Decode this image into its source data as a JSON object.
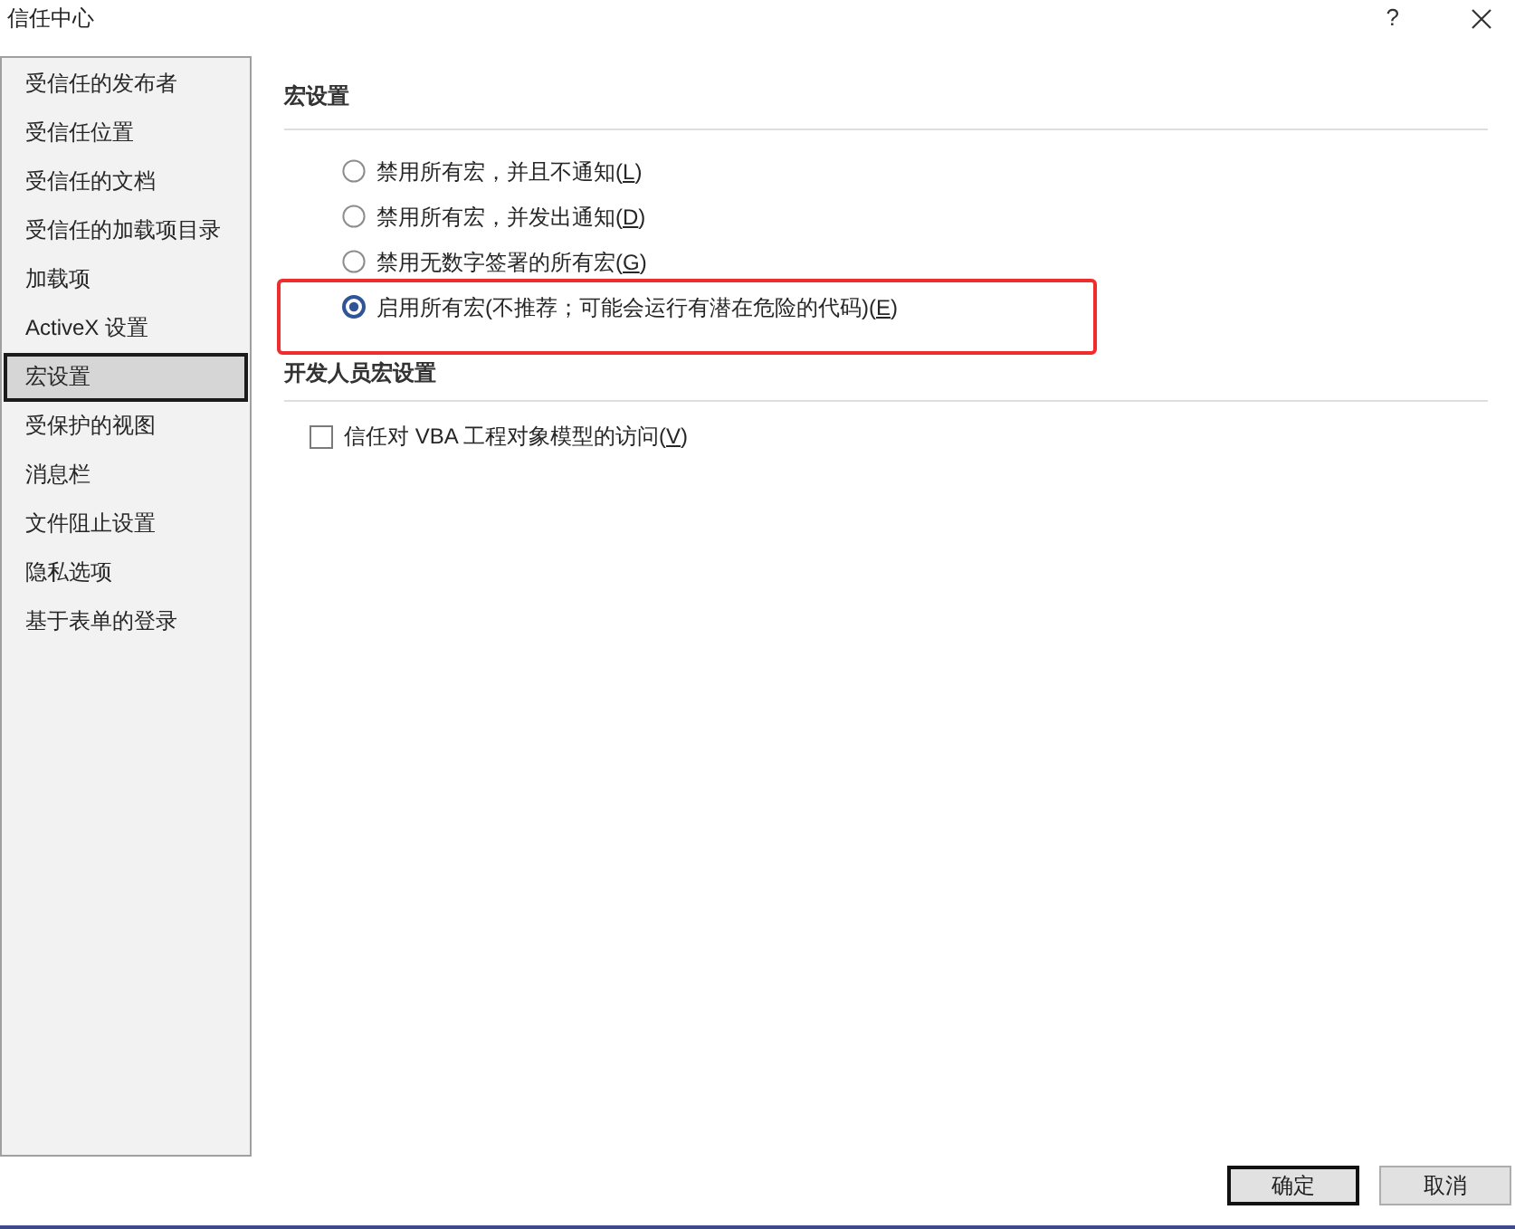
{
  "window": {
    "title": "信任中心",
    "help": "?"
  },
  "sidebar": {
    "items": [
      {
        "label": "受信任的发布者",
        "selected": false
      },
      {
        "label": "受信任位置",
        "selected": false
      },
      {
        "label": "受信任的文档",
        "selected": false
      },
      {
        "label": "受信任的加载项目录",
        "selected": false
      },
      {
        "label": "加载项",
        "selected": false
      },
      {
        "label": "ActiveX 设置",
        "selected": false
      },
      {
        "label": "宏设置",
        "selected": true
      },
      {
        "label": "受保护的视图",
        "selected": false
      },
      {
        "label": "消息栏",
        "selected": false
      },
      {
        "label": "文件阻止设置",
        "selected": false
      },
      {
        "label": "隐私选项",
        "selected": false
      },
      {
        "label": "基于表单的登录",
        "selected": false
      }
    ]
  },
  "macro_settings": {
    "heading": "宏设置",
    "options": [
      {
        "label": "禁用所有宏，并且不通知(L)",
        "selected": false,
        "highlighted": false
      },
      {
        "label": "禁用所有宏，并发出通知(D)",
        "selected": false,
        "highlighted": false
      },
      {
        "label": "禁用无数字签署的所有宏(G)",
        "selected": false,
        "highlighted": false
      },
      {
        "label": "启用所有宏(不推荐；可能会运行有潜在危险的代码)(E)",
        "selected": true,
        "highlighted": true
      }
    ]
  },
  "developer_settings": {
    "heading": "开发人员宏设置",
    "checkbox": {
      "label": "信任对 VBA 工程对象模型的访问(V)",
      "checked": false
    }
  },
  "buttons": [
    {
      "label": "确定",
      "default": true
    },
    {
      "label": "取消",
      "default": false
    }
  ]
}
